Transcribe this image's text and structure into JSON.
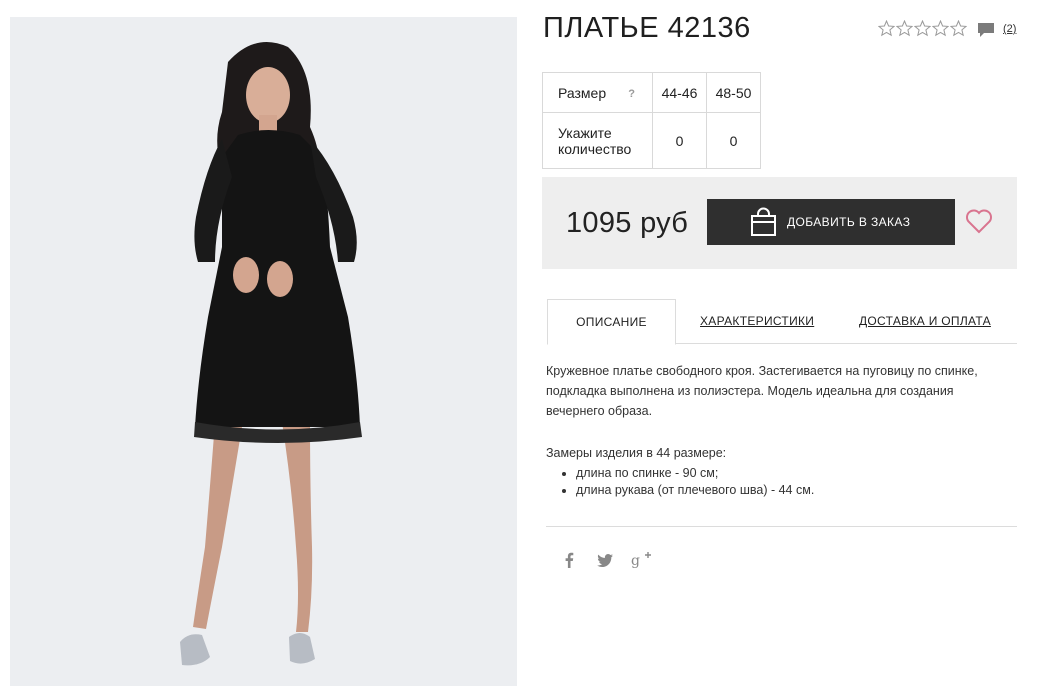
{
  "product": {
    "title": "ПЛАТЬЕ 42136",
    "rating_stars": 5,
    "rating_value": 0,
    "comments_count": "(2)"
  },
  "sizes": {
    "header_label": "Размер",
    "help_mark": "?",
    "quantity_label": "Укажите количество",
    "columns": [
      {
        "size": "44-46",
        "qty": "0"
      },
      {
        "size": "48-50",
        "qty": "0"
      }
    ]
  },
  "buy": {
    "price": "1095 руб",
    "add_label": "ДОБАВИТЬ В ЗАКАЗ"
  },
  "tabs": [
    {
      "label": "ОПИСАНИЕ",
      "active": true
    },
    {
      "label": "ХАРАКТЕРИСТИКИ",
      "active": false
    },
    {
      "label": "ДОСТАВКА И ОПЛАТА",
      "active": false
    }
  ],
  "description": {
    "text": "Кружевное платье свободного кроя. Застегивается на пуговицу по спинке, подкладка выполнена из полиэстера. Модель идеальна для создания вечернего образа.",
    "measures_title": "Замеры изделия в 44 размере:",
    "measures": [
      "длина по спинке - 90 см;",
      "длина рукава (от плечевого шва) - 44 см."
    ]
  },
  "social": [
    {
      "icon": "facebook-icon",
      "glyph": "f"
    },
    {
      "icon": "twitter-icon"
    },
    {
      "icon": "google-plus-icon",
      "glyph": "g+"
    }
  ],
  "colors": {
    "button_bg": "#2f2f2f",
    "buy_block_bg": "#eeeeee",
    "heart": "#d9748f",
    "photo_bg": "#eceef1"
  }
}
